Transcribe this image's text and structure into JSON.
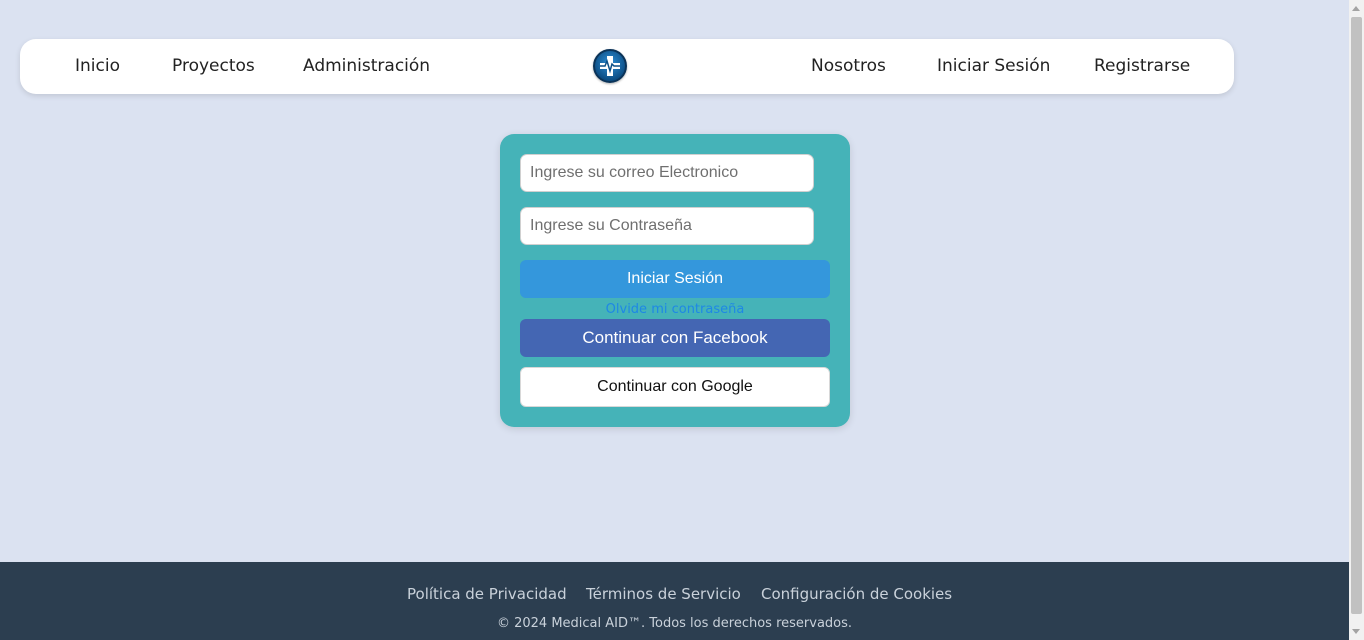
{
  "nav": {
    "left_links": [
      "Inicio",
      "Proyectos",
      "Administración"
    ],
    "right_links": [
      "Nosotros",
      "Iniciar Sesión",
      "Registrarse"
    ],
    "logo_icon": "medical-cross-icon"
  },
  "login": {
    "email_placeholder": "Ingrese su correo Electronico",
    "email_value": "",
    "password_placeholder": "Ingrese su Contraseña",
    "password_value": "",
    "login_button": "Iniciar Sesión",
    "forgot_link": "Olvide mi contraseña",
    "facebook_button": "Continuar con Facebook",
    "google_button": "Continuar con Google"
  },
  "footer": {
    "links": [
      "Política de Privacidad",
      "Términos de Servicio",
      "Configuración de Cookies"
    ],
    "copyright": "© 2024 Medical AID™. Todos los derechos reservados."
  },
  "colors": {
    "page_bg": "#dbe2f1",
    "card_bg": "#45b3b8",
    "login_btn": "#3497dc",
    "facebook_btn": "#4466b3",
    "footer_bg": "#2c3e50"
  }
}
